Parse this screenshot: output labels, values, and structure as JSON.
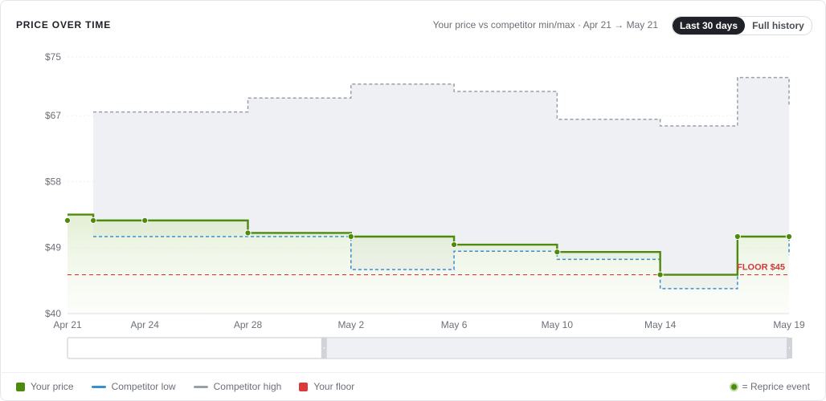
{
  "header": {
    "title": "PRICE OVER TIME",
    "subtitle": "Your price vs competitor min/max · Apr 21 → May 21",
    "range_active": "Last 30 days",
    "range_inactive": "Full history"
  },
  "legend": {
    "items": [
      {
        "label": "Your price",
        "color": "#4e8a0e",
        "kind": "square"
      },
      {
        "label": "Competitor low",
        "color": "#3a8fd0",
        "kind": "line"
      },
      {
        "label": "Competitor high",
        "color": "#9aa0a8",
        "kind": "line"
      },
      {
        "label": "Your floor",
        "color": "#d93a3a",
        "kind": "square"
      }
    ],
    "reprice_note": "= Reprice event"
  },
  "chart_data": {
    "type": "line",
    "step": true,
    "ylim": [
      40,
      75
    ],
    "yticks": [
      75,
      67,
      58,
      49,
      40
    ],
    "ytick_labels": [
      "$75",
      "$67",
      "$58",
      "$49",
      "$40"
    ],
    "xlim": [
      "2025-04-21",
      "2025-05-19"
    ],
    "xticks": [
      "2025-04-21",
      "2025-04-24",
      "2025-04-28",
      "2025-05-02",
      "2025-05-06",
      "2025-05-10",
      "2025-05-14",
      "2025-05-19"
    ],
    "xtick_labels": [
      "Apr 21",
      "Apr 24",
      "Apr 28",
      "May 2",
      "May 6",
      "May 10",
      "May 14",
      "May 19"
    ],
    "series": [
      {
        "name": "Your price",
        "color": "#4e8a0e",
        "points": [
          [
            "2025-04-20",
            53.5
          ],
          [
            "2025-04-22",
            52.7
          ],
          [
            "2025-04-28",
            51.0
          ],
          [
            "2025-05-02",
            50.5
          ],
          [
            "2025-05-06",
            49.4
          ],
          [
            "2025-05-10",
            48.4
          ],
          [
            "2025-05-14",
            45.3
          ],
          [
            "2025-05-17",
            50.5
          ],
          [
            "2025-05-19",
            50.5
          ]
        ],
        "reprice_events": [
          [
            "2025-04-21",
            52.7
          ],
          [
            "2025-04-22",
            52.7
          ],
          [
            "2025-04-24",
            52.7
          ],
          [
            "2025-04-28",
            51.0
          ],
          [
            "2025-05-02",
            50.5
          ],
          [
            "2025-05-06",
            49.4
          ],
          [
            "2025-05-10",
            48.4
          ],
          [
            "2025-05-14",
            45.3
          ],
          [
            "2025-05-17",
            50.5
          ],
          [
            "2025-05-19",
            50.5
          ]
        ]
      },
      {
        "name": "Competitor low",
        "color": "#3a8fd0",
        "points": [
          [
            "2025-04-22",
            50.5
          ],
          [
            "2025-05-02",
            46.0
          ],
          [
            "2025-05-06",
            48.5
          ],
          [
            "2025-05-10",
            47.4
          ],
          [
            "2025-05-14",
            43.4
          ],
          [
            "2025-05-17",
            50.5
          ],
          [
            "2025-05-19",
            48.0
          ]
        ]
      },
      {
        "name": "Competitor high",
        "color": "#9aa0a8",
        "points": [
          [
            "2025-04-22",
            67.5
          ],
          [
            "2025-04-28",
            69.4
          ],
          [
            "2025-05-02",
            71.3
          ],
          [
            "2025-05-06",
            70.3
          ],
          [
            "2025-05-10",
            66.5
          ],
          [
            "2025-05-14",
            65.6
          ],
          [
            "2025-05-17",
            72.2
          ],
          [
            "2025-05-19",
            68.5
          ]
        ]
      }
    ],
    "floor": {
      "value": 45.3,
      "label": "FLOOR $45",
      "color": "#d93a3a"
    },
    "navigator": {
      "window_start": "2025-05-02",
      "window_end": "2025-05-19"
    },
    "grid": true
  }
}
